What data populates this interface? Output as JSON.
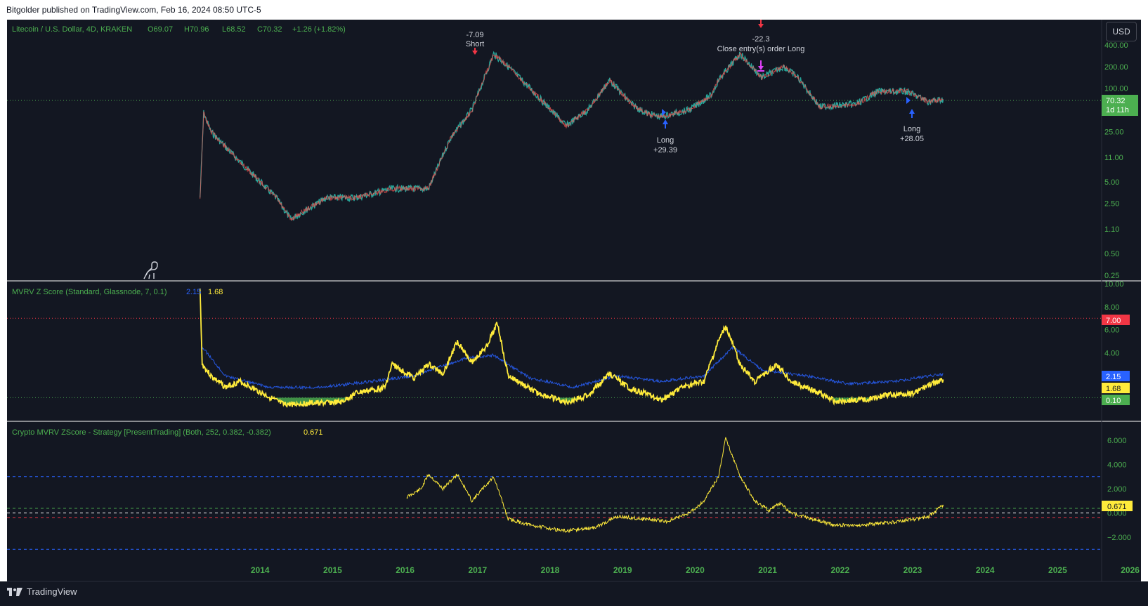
{
  "header": {
    "published": "Bitgolder published on TradingView.com, Feb 16, 2024 08:50 UTC-5"
  },
  "footer": {
    "brand": "TradingView"
  },
  "currency_button": "USD",
  "colors": {
    "up": "#26a69a",
    "down": "#ef5350",
    "yellow": "#ffeb3b",
    "blue": "#2962ff",
    "green_fill": "#4caf50",
    "red_line": "#f23645",
    "background": "#131722"
  },
  "chart_data": [
    {
      "type": "line",
      "pane": "price",
      "legend": {
        "symbol": "Litecoin / U.S. Dollar, 4D, KRAKEN",
        "open": "O69.07",
        "high": "H70.96",
        "low": "L68.52",
        "close": "C70.32",
        "change": "+1.26 (+1.82%)"
      },
      "scale": "log",
      "y_ticks": [
        "400.00",
        "200.00",
        "100.00",
        "25.00",
        "11.00",
        "5.00",
        "2.50",
        "1.10",
        "0.50",
        "0.25"
      ],
      "last_price": "70.32",
      "countdown": "1d 11h",
      "series": [
        {
          "values_by_year": [
            [
              2013.85,
              3
            ],
            [
              2013.9,
              45
            ],
            [
              2014.0,
              25
            ],
            [
              2014.3,
              12
            ],
            [
              2014.6,
              6
            ],
            [
              2014.9,
              3
            ],
            [
              2015.1,
              1.5
            ],
            [
              2015.3,
              2
            ],
            [
              2015.6,
              3
            ],
            [
              2016.0,
              3
            ],
            [
              2016.5,
              4
            ],
            [
              2017.0,
              4
            ],
            [
              2017.3,
              20
            ],
            [
              2017.6,
              50
            ],
            [
              2017.9,
              300
            ],
            [
              2018.1,
              200
            ],
            [
              2018.4,
              100
            ],
            [
              2018.9,
              30
            ],
            [
              2019.2,
              50
            ],
            [
              2019.5,
              130
            ],
            [
              2019.8,
              60
            ],
            [
              2020.0,
              45
            ],
            [
              2020.2,
              40
            ],
            [
              2020.6,
              50
            ],
            [
              2020.9,
              80
            ],
            [
              2021.0,
              130
            ],
            [
              2021.3,
              300
            ],
            [
              2021.6,
              140
            ],
            [
              2021.9,
              200
            ],
            [
              2022.1,
              140
            ],
            [
              2022.4,
              55
            ],
            [
              2022.9,
              60
            ],
            [
              2023.2,
              90
            ],
            [
              2023.6,
              90
            ],
            [
              2023.9,
              65
            ],
            [
              2024.1,
              70
            ]
          ]
        }
      ],
      "annotations": [
        {
          "line1": "-7.09",
          "line2": "Short"
        },
        {
          "line1": "-22.3",
          "line2": "Close entry(s) order Long"
        },
        {
          "line1": "Long",
          "line2": "+29.39"
        },
        {
          "line1": "Long",
          "line2": "+28.05"
        }
      ]
    },
    {
      "type": "line",
      "pane": "mvrv",
      "legend": {
        "title": "MVRV Z Score (Standard, Glassnode, 7, 0.1)",
        "blue_value": "2.15",
        "yellow_value": "1.68"
      },
      "ylim": [
        -0.8,
        10
      ],
      "y_ticks": [
        "10.00",
        "8.00",
        "6.00",
        "4.00"
      ],
      "levels": {
        "red": "7.00",
        "blue": "2.15",
        "yellow": "1.68",
        "green": "0.10"
      },
      "series": [
        {
          "name": "yellow",
          "values_by_year": [
            [
              2013.85,
              9.5
            ],
            [
              2013.88,
              3
            ],
            [
              2014.0,
              2
            ],
            [
              2014.2,
              1
            ],
            [
              2014.4,
              1.5
            ],
            [
              2014.7,
              0.5
            ],
            [
              2015.0,
              -0.5
            ],
            [
              2015.3,
              -0.4
            ],
            [
              2015.8,
              -0.3
            ],
            [
              2016.0,
              0.5
            ],
            [
              2016.4,
              1
            ],
            [
              2016.5,
              3
            ],
            [
              2016.8,
              1.8
            ],
            [
              2017.0,
              3
            ],
            [
              2017.2,
              2.2
            ],
            [
              2017.4,
              5
            ],
            [
              2017.6,
              3.2
            ],
            [
              2017.8,
              4.5
            ],
            [
              2017.95,
              6.6
            ],
            [
              2018.1,
              2
            ],
            [
              2018.5,
              0.5
            ],
            [
              2018.9,
              -0.3
            ],
            [
              2019.2,
              0.3
            ],
            [
              2019.5,
              2.2
            ],
            [
              2019.8,
              0.8
            ],
            [
              2020.0,
              0.5
            ],
            [
              2020.2,
              -0.1
            ],
            [
              2020.5,
              1
            ],
            [
              2020.8,
              1.5
            ],
            [
              2021.0,
              5
            ],
            [
              2021.1,
              6.3
            ],
            [
              2021.3,
              3
            ],
            [
              2021.5,
              1.5
            ],
            [
              2021.8,
              3
            ],
            [
              2022.0,
              1.5
            ],
            [
              2022.4,
              0.5
            ],
            [
              2022.6,
              -0.2
            ],
            [
              2023.0,
              -0.1
            ],
            [
              2023.3,
              0.3
            ],
            [
              2023.7,
              0.5
            ],
            [
              2023.9,
              1.2
            ],
            [
              2024.1,
              1.68
            ]
          ]
        },
        {
          "name": "blue",
          "values_by_year": [
            [
              2013.88,
              4.5
            ],
            [
              2014.2,
              2
            ],
            [
              2014.8,
              1
            ],
            [
              2015.5,
              1
            ],
            [
              2016.2,
              1.5
            ],
            [
              2016.8,
              2
            ],
            [
              2017.5,
              3.5
            ],
            [
              2017.9,
              3.8
            ],
            [
              2018.4,
              1.8
            ],
            [
              2019.0,
              1
            ],
            [
              2019.6,
              2
            ],
            [
              2020.2,
              1.5
            ],
            [
              2020.8,
              2
            ],
            [
              2021.2,
              4.5
            ],
            [
              2021.6,
              2.5
            ],
            [
              2022.2,
              2
            ],
            [
              2022.8,
              1.3
            ],
            [
              2023.4,
              1.5
            ],
            [
              2024.1,
              2.15
            ]
          ]
        }
      ]
    },
    {
      "type": "line",
      "pane": "strategy",
      "legend": {
        "title": "Crypto MVRV ZScore - Strategy [PresentTrading] (Both, 252, 0.382, -0.382)",
        "value": "0.671"
      },
      "ylim": [
        -3.6,
        6.8
      ],
      "y_ticks": [
        "6.000",
        "4.000",
        "2.000",
        "0.000",
        "−2.000"
      ],
      "last_value": "0.671",
      "levels": [
        3.0,
        0.382,
        0,
        -0.382,
        -3.0
      ],
      "series": [
        {
          "name": "zscore",
          "values_by_year": [
            [
              2016.7,
              1.3
            ],
            [
              2016.9,
              2
            ],
            [
              2017.0,
              3.2
            ],
            [
              2017.2,
              2
            ],
            [
              2017.4,
              3.2
            ],
            [
              2017.6,
              1
            ],
            [
              2017.9,
              3
            ],
            [
              2018.1,
              -0.5
            ],
            [
              2018.4,
              -1
            ],
            [
              2018.9,
              -1.5
            ],
            [
              2019.3,
              -1.2
            ],
            [
              2019.6,
              -0.3
            ],
            [
              2020.0,
              -0.5
            ],
            [
              2020.3,
              -0.7
            ],
            [
              2020.6,
              0
            ],
            [
              2020.8,
              1
            ],
            [
              2021.0,
              3
            ],
            [
              2021.1,
              6.2
            ],
            [
              2021.3,
              3
            ],
            [
              2021.5,
              1
            ],
            [
              2021.7,
              0.2
            ],
            [
              2021.85,
              0.8
            ],
            [
              2022.0,
              0
            ],
            [
              2022.3,
              -0.5
            ],
            [
              2022.6,
              -1
            ],
            [
              2023.0,
              -1
            ],
            [
              2023.5,
              -0.7
            ],
            [
              2023.9,
              -0.3
            ],
            [
              2024.1,
              0.671
            ]
          ]
        }
      ]
    }
  ],
  "x_axis": {
    "ticks": [
      "2014",
      "2015",
      "2016",
      "2017",
      "2018",
      "2019",
      "2020",
      "2021",
      "2022",
      "2023",
      "2024",
      "2025",
      "2026"
    ]
  }
}
